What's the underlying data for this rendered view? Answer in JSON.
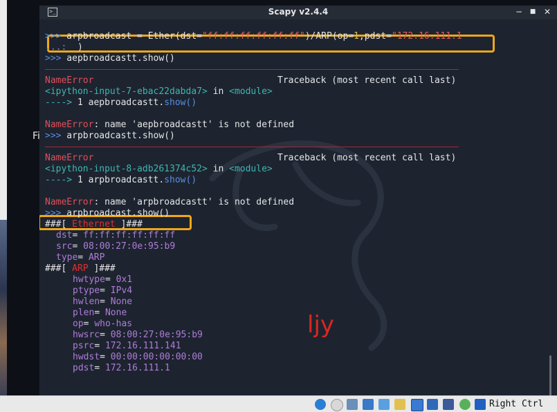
{
  "host": {
    "partial_label": "Fi"
  },
  "window": {
    "title": "Scapy v2.4.4",
    "controls": {
      "minimize": "−",
      "maximize": "■",
      "close": "✕"
    }
  },
  "terminal": {
    "cmd1": {
      "prompt": ">>>",
      "pre": " arpbroadcast = Ether(dst=",
      "s1": "\"ff:ff:ff:ff:ff:ff\"",
      "mid1": ")/ARP(op=",
      "n1": "1",
      "mid2": ",pdst=",
      "s2": "\"172.16.111.1"
    },
    "cont": {
      "prompt": "...:",
      "text": "  )"
    },
    "cmd2": {
      "prompt": ">>>",
      "text": " aepbroadcastt.show()"
    },
    "tb1": {
      "name": "NameError",
      "traceback": "Traceback (most recent call last)",
      "input": "<ipython-input-7-ebac22dabda7>",
      "in": " in ",
      "module": "<module>",
      "arrow": "---->",
      "arrow_line": " 1 ",
      "call_obj": "aepbroadcastt.",
      "call_fn": "show",
      "call_paren": "()",
      "err_name": "NameError",
      "err_msg": ": name 'aepbroadcastt' is not defined"
    },
    "cmd3": {
      "prompt": ">>>",
      "text": " arpbroadcastt.show()"
    },
    "tb2": {
      "name": "NameError",
      "traceback": "Traceback (most recent call last)",
      "input": "<ipython-input-8-adb261374c52>",
      "in": " in ",
      "module": "<module>",
      "arrow": "---->",
      "arrow_line": " 1 ",
      "call_obj": "arpbroadcastt.",
      "call_fn": "show",
      "call_paren": "()",
      "err_name": "NameError",
      "err_msg": ": name 'arpbroadcastt' is not defined"
    },
    "cmd4": {
      "prompt": ">>>",
      "text": " arpbroadcast.show()"
    },
    "show_output": {
      "ether_header": {
        "pre": "###[ ",
        "name": "Ethernet",
        "post": " ]###"
      },
      "ether_fields": [
        {
          "name": "dst",
          "value": "ff:ff:ff:ff:ff:ff"
        },
        {
          "name": "src",
          "value": "08:00:27:0e:95:b9"
        },
        {
          "name": "type",
          "value": "ARP"
        }
      ],
      "arp_header": {
        "pre": "###[ ",
        "name": "ARP",
        "post": " ]###"
      },
      "arp_fields": [
        {
          "name": "hwtype",
          "value": "0x1"
        },
        {
          "name": "ptype",
          "value": "IPv4"
        },
        {
          "name": "hwlen",
          "value": "None"
        },
        {
          "name": "plen",
          "value": "None"
        },
        {
          "name": "op",
          "value": "who-has"
        },
        {
          "name": "hwsrc",
          "value": "08:00:27:0e:95:b9"
        },
        {
          "name": "psrc",
          "value": "172.16.111.141"
        },
        {
          "name": "hwdst",
          "value": "00:00:00:00:00:00"
        },
        {
          "name": "pdst",
          "value": "172.16.111.1"
        }
      ]
    },
    "watermark": "ljy"
  },
  "statusbar": {
    "host_key": "Right Ctrl",
    "icons": [
      "help-icon",
      "optical-disc-icon",
      "audio-icon",
      "network-icon",
      "usb-icon",
      "shared-folder-icon",
      "display-icon",
      "recording-icon",
      "vm-icon",
      "capture-icon",
      "keyboard-capture-icon"
    ]
  },
  "colors": {
    "highlight": "#f0a818",
    "error": "#e0505a",
    "prompt": "#5a8de0",
    "watermark": "#d8281f"
  }
}
